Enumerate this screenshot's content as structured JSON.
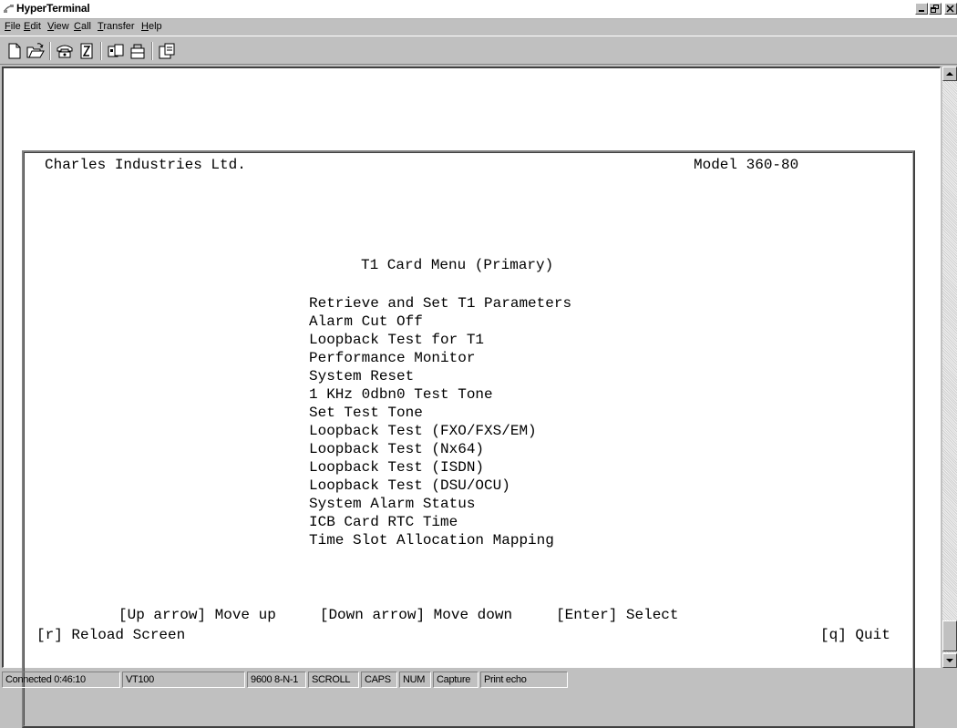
{
  "window": {
    "title": "HyperTerminal"
  },
  "menu": {
    "items": [
      {
        "label": "File",
        "ul": "F",
        "rest": "ile"
      },
      {
        "label": "Edit",
        "ul": "E",
        "rest": "dit"
      },
      {
        "label": "View",
        "ul": "V",
        "rest": "iew"
      },
      {
        "label": "Call",
        "ul": "C",
        "rest": "all"
      },
      {
        "label": "Transfer",
        "ul": "T",
        "rest": "ransfer"
      },
      {
        "label": "Help",
        "ul": "H",
        "rest": "elp"
      }
    ]
  },
  "toolbar": {
    "buttons": [
      "new-icon",
      "open-icon",
      "connect-icon",
      "disconnect-icon",
      "send-icon",
      "receive-icon",
      "properties-icon"
    ]
  },
  "terminal": {
    "company": "Charles Industries Ltd.",
    "model": "Model 360-80",
    "menu_title": "T1 Card Menu (Primary)",
    "menu_items": [
      "Retrieve and Set T1 Parameters",
      "Alarm Cut Off",
      "Loopback Test for T1",
      "Performance Monitor",
      "System Reset",
      "1 KHz 0dbn0 Test Tone",
      "Set Test Tone",
      "Loopback Test (FXO/FXS/EM)",
      "Loopback Test (Nx64)",
      "Loopback Test (ISDN)",
      "Loopback Test (DSU/OCU)",
      "System Alarm Status",
      "ICB Card RTC Time",
      "Time Slot Allocation Mapping"
    ],
    "help_line": "[Up arrow] Move up     [Down arrow] Move down     [Enter] Select",
    "reload": "[r] Reload Screen",
    "quit": "[q] Quit"
  },
  "status": {
    "connected": "Connected 0:46:10",
    "emulation": "VT100",
    "settings": "9600 8-N-1",
    "scroll": "SCROLL",
    "caps": "CAPS",
    "num": "NUM",
    "capture": "Capture",
    "print_echo": "Print echo"
  },
  "colors": {
    "chrome": "#c0c0c0",
    "terminal_bg": "#ffffff",
    "text": "#000000"
  }
}
